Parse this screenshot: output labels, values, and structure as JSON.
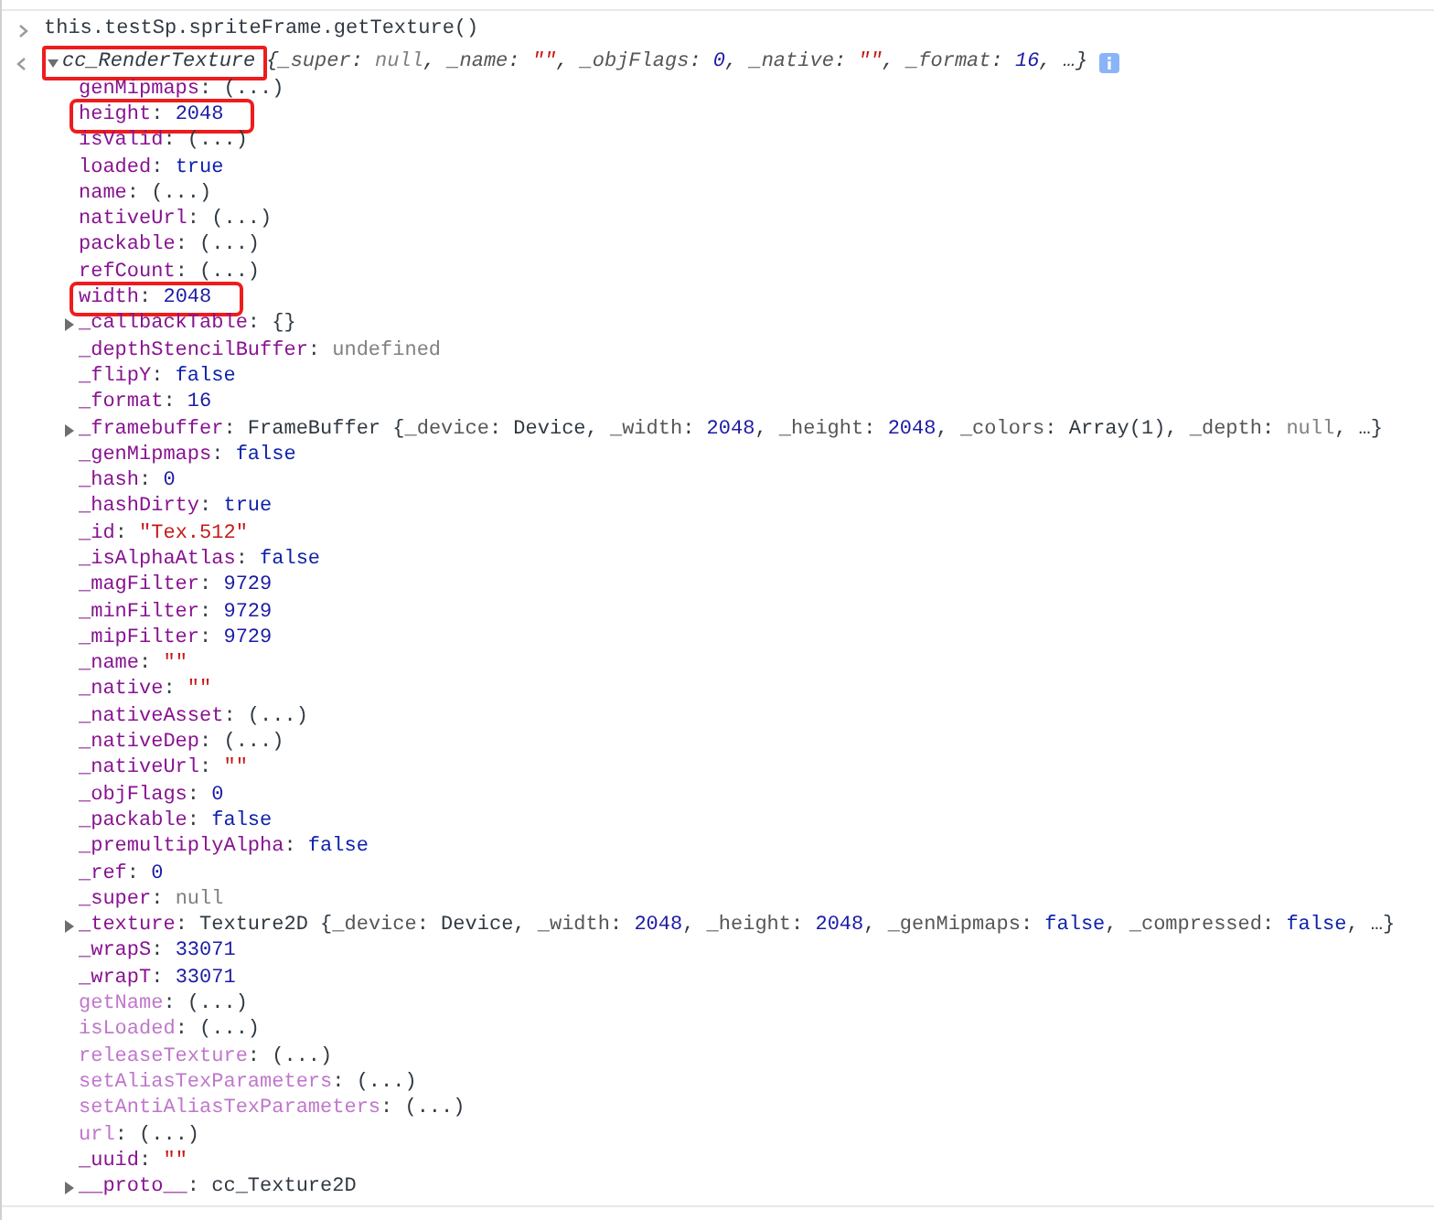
{
  "command": {
    "text": "this.testSp.spriteFrame.getTexture()"
  },
  "result": {
    "class_name": "cc_RenderTexture",
    "expanded": true,
    "highlighted": true,
    "preview": [
      {
        "text": "{",
        "kind": "plain"
      },
      {
        "text": "_super",
        "kind": "pkey"
      },
      {
        "text": ": ",
        "kind": "plain"
      },
      {
        "text": "null",
        "kind": "null"
      },
      {
        "text": ", ",
        "kind": "plain"
      },
      {
        "text": "_name",
        "kind": "pkey"
      },
      {
        "text": ": ",
        "kind": "plain"
      },
      {
        "text": "\"\"",
        "kind": "string"
      },
      {
        "text": ", ",
        "kind": "plain"
      },
      {
        "text": "_objFlags",
        "kind": "pkey"
      },
      {
        "text": ": ",
        "kind": "plain"
      },
      {
        "text": "0",
        "kind": "number"
      },
      {
        "text": ", ",
        "kind": "plain"
      },
      {
        "text": "_native",
        "kind": "pkey"
      },
      {
        "text": ": ",
        "kind": "plain"
      },
      {
        "text": "\"\"",
        "kind": "string"
      },
      {
        "text": ", ",
        "kind": "plain"
      },
      {
        "text": "_format",
        "kind": "pkey"
      },
      {
        "text": ": ",
        "kind": "plain"
      },
      {
        "text": "16",
        "kind": "number"
      },
      {
        "text": ", …}",
        "kind": "plain"
      }
    ],
    "properties": [
      {
        "kind": "value",
        "highlighted": false,
        "parts": [
          {
            "text": "genMipmaps",
            "kind": "key"
          },
          {
            "text": ": ",
            "kind": "plain"
          },
          {
            "text": "(...)",
            "kind": "getter"
          }
        ]
      },
      {
        "kind": "value",
        "highlighted": true,
        "parts": [
          {
            "text": "height",
            "kind": "key"
          },
          {
            "text": ": ",
            "kind": "plain"
          },
          {
            "text": "2048",
            "kind": "number"
          }
        ]
      },
      {
        "kind": "value",
        "highlighted": false,
        "parts": [
          {
            "text": "isValid",
            "kind": "key"
          },
          {
            "text": ": ",
            "kind": "plain"
          },
          {
            "text": "(...)",
            "kind": "getter"
          }
        ]
      },
      {
        "kind": "value",
        "highlighted": false,
        "parts": [
          {
            "text": "loaded",
            "kind": "key"
          },
          {
            "text": ": ",
            "kind": "plain"
          },
          {
            "text": "true",
            "kind": "bool"
          }
        ]
      },
      {
        "kind": "value",
        "highlighted": false,
        "parts": [
          {
            "text": "name",
            "kind": "key"
          },
          {
            "text": ": ",
            "kind": "plain"
          },
          {
            "text": "(...)",
            "kind": "getter"
          }
        ]
      },
      {
        "kind": "value",
        "highlighted": false,
        "parts": [
          {
            "text": "nativeUrl",
            "kind": "key"
          },
          {
            "text": ": ",
            "kind": "plain"
          },
          {
            "text": "(...)",
            "kind": "getter"
          }
        ]
      },
      {
        "kind": "value",
        "highlighted": false,
        "parts": [
          {
            "text": "packable",
            "kind": "key"
          },
          {
            "text": ": ",
            "kind": "plain"
          },
          {
            "text": "(...)",
            "kind": "getter"
          }
        ]
      },
      {
        "kind": "value",
        "highlighted": false,
        "parts": [
          {
            "text": "refCount",
            "kind": "key"
          },
          {
            "text": ": ",
            "kind": "plain"
          },
          {
            "text": "(...)",
            "kind": "getter"
          }
        ]
      },
      {
        "kind": "value",
        "highlighted": true,
        "parts": [
          {
            "text": "width",
            "kind": "key"
          },
          {
            "text": ": ",
            "kind": "plain"
          },
          {
            "text": "2048",
            "kind": "number"
          }
        ]
      },
      {
        "kind": "object",
        "highlighted": false,
        "parts": [
          {
            "text": "_callbackTable",
            "kind": "key"
          },
          {
            "text": ": ",
            "kind": "plain"
          },
          {
            "text": "{}",
            "kind": "plain"
          }
        ]
      },
      {
        "kind": "value",
        "highlighted": false,
        "parts": [
          {
            "text": "_depthStencilBuffer",
            "kind": "key"
          },
          {
            "text": ": ",
            "kind": "plain"
          },
          {
            "text": "undefined",
            "kind": "null"
          }
        ]
      },
      {
        "kind": "value",
        "highlighted": false,
        "parts": [
          {
            "text": "_flipY",
            "kind": "key"
          },
          {
            "text": ": ",
            "kind": "plain"
          },
          {
            "text": "false",
            "kind": "bool"
          }
        ]
      },
      {
        "kind": "value",
        "highlighted": false,
        "parts": [
          {
            "text": "_format",
            "kind": "key"
          },
          {
            "text": ": ",
            "kind": "plain"
          },
          {
            "text": "16",
            "kind": "number"
          }
        ]
      },
      {
        "kind": "object",
        "highlighted": false,
        "parts": [
          {
            "text": "_framebuffer",
            "kind": "key"
          },
          {
            "text": ": ",
            "kind": "plain"
          },
          {
            "text": "FrameBuffer {",
            "kind": "plain"
          },
          {
            "text": "_device",
            "kind": "pkey"
          },
          {
            "text": ": Device, ",
            "kind": "plain"
          },
          {
            "text": "_width",
            "kind": "pkey"
          },
          {
            "text": ": ",
            "kind": "plain"
          },
          {
            "text": "2048",
            "kind": "number"
          },
          {
            "text": ", ",
            "kind": "plain"
          },
          {
            "text": "_height",
            "kind": "pkey"
          },
          {
            "text": ": ",
            "kind": "plain"
          },
          {
            "text": "2048",
            "kind": "number"
          },
          {
            "text": ", ",
            "kind": "plain"
          },
          {
            "text": "_colors",
            "kind": "pkey"
          },
          {
            "text": ": Array(1), ",
            "kind": "plain"
          },
          {
            "text": "_depth",
            "kind": "pkey"
          },
          {
            "text": ": ",
            "kind": "plain"
          },
          {
            "text": "null",
            "kind": "null"
          },
          {
            "text": ", …}",
            "kind": "plain"
          }
        ]
      },
      {
        "kind": "value",
        "highlighted": false,
        "parts": [
          {
            "text": "_genMipmaps",
            "kind": "key"
          },
          {
            "text": ": ",
            "kind": "plain"
          },
          {
            "text": "false",
            "kind": "bool"
          }
        ]
      },
      {
        "kind": "value",
        "highlighted": false,
        "parts": [
          {
            "text": "_hash",
            "kind": "key"
          },
          {
            "text": ": ",
            "kind": "plain"
          },
          {
            "text": "0",
            "kind": "number"
          }
        ]
      },
      {
        "kind": "value",
        "highlighted": false,
        "parts": [
          {
            "text": "_hashDirty",
            "kind": "key"
          },
          {
            "text": ": ",
            "kind": "plain"
          },
          {
            "text": "true",
            "kind": "bool"
          }
        ]
      },
      {
        "kind": "value",
        "highlighted": false,
        "parts": [
          {
            "text": "_id",
            "kind": "key"
          },
          {
            "text": ": ",
            "kind": "plain"
          },
          {
            "text": "\"Tex.512\"",
            "kind": "string"
          }
        ]
      },
      {
        "kind": "value",
        "highlighted": false,
        "parts": [
          {
            "text": "_isAlphaAtlas",
            "kind": "key"
          },
          {
            "text": ": ",
            "kind": "plain"
          },
          {
            "text": "false",
            "kind": "bool"
          }
        ]
      },
      {
        "kind": "value",
        "highlighted": false,
        "parts": [
          {
            "text": "_magFilter",
            "kind": "key"
          },
          {
            "text": ": ",
            "kind": "plain"
          },
          {
            "text": "9729",
            "kind": "number"
          }
        ]
      },
      {
        "kind": "value",
        "highlighted": false,
        "parts": [
          {
            "text": "_minFilter",
            "kind": "key"
          },
          {
            "text": ": ",
            "kind": "plain"
          },
          {
            "text": "9729",
            "kind": "number"
          }
        ]
      },
      {
        "kind": "value",
        "highlighted": false,
        "parts": [
          {
            "text": "_mipFilter",
            "kind": "key"
          },
          {
            "text": ": ",
            "kind": "plain"
          },
          {
            "text": "9729",
            "kind": "number"
          }
        ]
      },
      {
        "kind": "value",
        "highlighted": false,
        "parts": [
          {
            "text": "_name",
            "kind": "key"
          },
          {
            "text": ": ",
            "kind": "plain"
          },
          {
            "text": "\"\"",
            "kind": "string"
          }
        ]
      },
      {
        "kind": "value",
        "highlighted": false,
        "parts": [
          {
            "text": "_native",
            "kind": "key"
          },
          {
            "text": ": ",
            "kind": "plain"
          },
          {
            "text": "\"\"",
            "kind": "string"
          }
        ]
      },
      {
        "kind": "value",
        "highlighted": false,
        "parts": [
          {
            "text": "_nativeAsset",
            "kind": "key"
          },
          {
            "text": ": ",
            "kind": "plain"
          },
          {
            "text": "(...)",
            "kind": "getter"
          }
        ]
      },
      {
        "kind": "value",
        "highlighted": false,
        "parts": [
          {
            "text": "_nativeDep",
            "kind": "key"
          },
          {
            "text": ": ",
            "kind": "plain"
          },
          {
            "text": "(...)",
            "kind": "getter"
          }
        ]
      },
      {
        "kind": "value",
        "highlighted": false,
        "parts": [
          {
            "text": "_nativeUrl",
            "kind": "key"
          },
          {
            "text": ": ",
            "kind": "plain"
          },
          {
            "text": "\"\"",
            "kind": "string"
          }
        ]
      },
      {
        "kind": "value",
        "highlighted": false,
        "parts": [
          {
            "text": "_objFlags",
            "kind": "key"
          },
          {
            "text": ": ",
            "kind": "plain"
          },
          {
            "text": "0",
            "kind": "number"
          }
        ]
      },
      {
        "kind": "value",
        "highlighted": false,
        "parts": [
          {
            "text": "_packable",
            "kind": "key"
          },
          {
            "text": ": ",
            "kind": "plain"
          },
          {
            "text": "false",
            "kind": "bool"
          }
        ]
      },
      {
        "kind": "value",
        "highlighted": false,
        "parts": [
          {
            "text": "_premultiplyAlpha",
            "kind": "key"
          },
          {
            "text": ": ",
            "kind": "plain"
          },
          {
            "text": "false",
            "kind": "bool"
          }
        ]
      },
      {
        "kind": "value",
        "highlighted": false,
        "parts": [
          {
            "text": "_ref",
            "kind": "key"
          },
          {
            "text": ": ",
            "kind": "plain"
          },
          {
            "text": "0",
            "kind": "number"
          }
        ]
      },
      {
        "kind": "value",
        "highlighted": false,
        "parts": [
          {
            "text": "_super",
            "kind": "key"
          },
          {
            "text": ": ",
            "kind": "plain"
          },
          {
            "text": "null",
            "kind": "null"
          }
        ]
      },
      {
        "kind": "object",
        "highlighted": false,
        "parts": [
          {
            "text": "_texture",
            "kind": "key"
          },
          {
            "text": ": ",
            "kind": "plain"
          },
          {
            "text": "Texture2D {",
            "kind": "plain"
          },
          {
            "text": "_device",
            "kind": "pkey"
          },
          {
            "text": ": Device, ",
            "kind": "plain"
          },
          {
            "text": "_width",
            "kind": "pkey"
          },
          {
            "text": ": ",
            "kind": "plain"
          },
          {
            "text": "2048",
            "kind": "number"
          },
          {
            "text": ", ",
            "kind": "plain"
          },
          {
            "text": "_height",
            "kind": "pkey"
          },
          {
            "text": ": ",
            "kind": "plain"
          },
          {
            "text": "2048",
            "kind": "number"
          },
          {
            "text": ", ",
            "kind": "plain"
          },
          {
            "text": "_genMipmaps",
            "kind": "pkey"
          },
          {
            "text": ": ",
            "kind": "plain"
          },
          {
            "text": "false",
            "kind": "bool"
          },
          {
            "text": ", ",
            "kind": "plain"
          },
          {
            "text": "_compressed",
            "kind": "pkey"
          },
          {
            "text": ": ",
            "kind": "plain"
          },
          {
            "text": "false",
            "kind": "bool"
          },
          {
            "text": ", …}",
            "kind": "plain"
          }
        ]
      },
      {
        "kind": "value",
        "highlighted": false,
        "parts": [
          {
            "text": "_wrapS",
            "kind": "key"
          },
          {
            "text": ": ",
            "kind": "plain"
          },
          {
            "text": "33071",
            "kind": "number"
          }
        ]
      },
      {
        "kind": "value",
        "highlighted": false,
        "parts": [
          {
            "text": "_wrapT",
            "kind": "key"
          },
          {
            "text": ": ",
            "kind": "plain"
          },
          {
            "text": "33071",
            "kind": "number"
          }
        ]
      },
      {
        "kind": "value",
        "highlighted": false,
        "parts": [
          {
            "text": "getName",
            "kind": "key2"
          },
          {
            "text": ": ",
            "kind": "plain"
          },
          {
            "text": "(...)",
            "kind": "getter"
          }
        ]
      },
      {
        "kind": "value",
        "highlighted": false,
        "parts": [
          {
            "text": "isLoaded",
            "kind": "key2"
          },
          {
            "text": ": ",
            "kind": "plain"
          },
          {
            "text": "(...)",
            "kind": "getter"
          }
        ]
      },
      {
        "kind": "value",
        "highlighted": false,
        "parts": [
          {
            "text": "releaseTexture",
            "kind": "key2"
          },
          {
            "text": ": ",
            "kind": "plain"
          },
          {
            "text": "(...)",
            "kind": "getter"
          }
        ]
      },
      {
        "kind": "value",
        "highlighted": false,
        "parts": [
          {
            "text": "setAliasTexParameters",
            "kind": "key2"
          },
          {
            "text": ": ",
            "kind": "plain"
          },
          {
            "text": "(...)",
            "kind": "getter"
          }
        ]
      },
      {
        "kind": "value",
        "highlighted": false,
        "parts": [
          {
            "text": "setAntiAliasTexParameters",
            "kind": "key2"
          },
          {
            "text": ": ",
            "kind": "plain"
          },
          {
            "text": "(...)",
            "kind": "getter"
          }
        ]
      },
      {
        "kind": "value",
        "highlighted": false,
        "parts": [
          {
            "text": "url",
            "kind": "key2"
          },
          {
            "text": ": ",
            "kind": "plain"
          },
          {
            "text": "(...)",
            "kind": "getter"
          }
        ]
      },
      {
        "kind": "value",
        "highlighted": false,
        "parts": [
          {
            "text": "_uuid",
            "kind": "key"
          },
          {
            "text": ": ",
            "kind": "plain"
          },
          {
            "text": "\"\"",
            "kind": "string"
          }
        ]
      },
      {
        "kind": "object",
        "highlighted": false,
        "parts": [
          {
            "text": "__proto__",
            "kind": "key"
          },
          {
            "text": ": ",
            "kind": "plain"
          },
          {
            "text": "cc_Texture2D",
            "kind": "plain"
          }
        ]
      }
    ]
  }
}
